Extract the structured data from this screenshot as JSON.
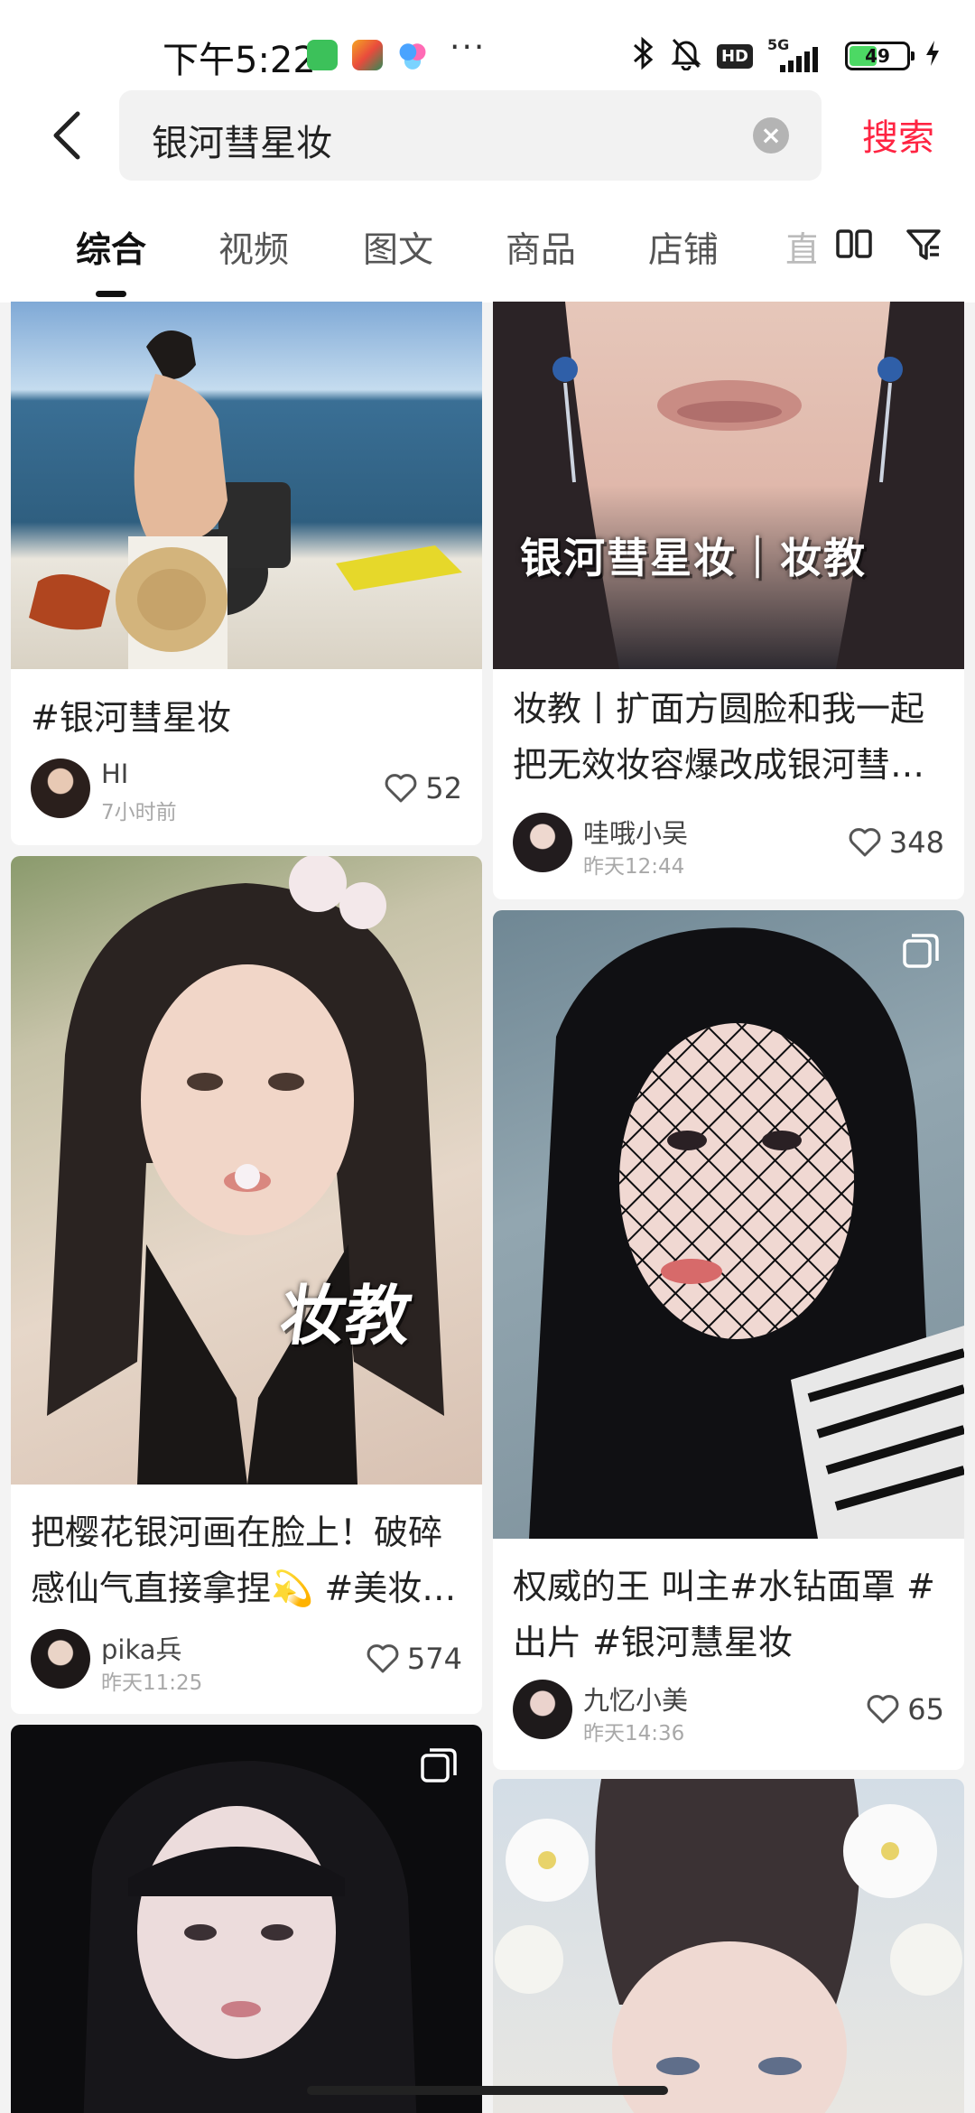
{
  "status": {
    "time": "下午5:22",
    "net_label": "5G",
    "hd_label": "HD",
    "battery_level": "49",
    "battery_fraction": 0.49
  },
  "search": {
    "query": "银河彗星妆",
    "button_label": "搜索"
  },
  "tabs": [
    {
      "label": "综合",
      "active": true
    },
    {
      "label": "视频"
    },
    {
      "label": "图文"
    },
    {
      "label": "商品"
    },
    {
      "label": "店铺"
    },
    {
      "label": "直"
    }
  ],
  "feed": [
    {
      "title": "#银河彗星妆",
      "author": "HI",
      "time": "7小时前",
      "likes": "52"
    },
    {
      "overlay": "银河彗星妆｜妆教",
      "title": "妆教丨扩面方圆脸和我一起把无效妆容爆改成银河彗…",
      "author": "哇哦小吴",
      "time": "昨天12:44",
      "likes": "348"
    },
    {
      "overlay": "妆教",
      "title": "把樱花银河画在脸上！破碎感仙气直接拿捏💫 #美妆…",
      "author": "pika兵",
      "time": "昨天11:25",
      "likes": "574"
    },
    {
      "title": "权威的王 叫主#水钻面罩 #出片 #银河慧星妆",
      "author": "九忆小美",
      "time": "昨天14:36",
      "likes": "65"
    },
    {},
    {}
  ],
  "icons": {
    "back": "chevron-left-icon",
    "clear": "clear-icon",
    "layout": "double-column-icon",
    "filter": "filter-icon",
    "like": "heart-icon",
    "multi": "multi-image-icon"
  },
  "colors": {
    "accent": "#ff2442",
    "battery": "#4cd964",
    "background": "#f3f3f3"
  }
}
